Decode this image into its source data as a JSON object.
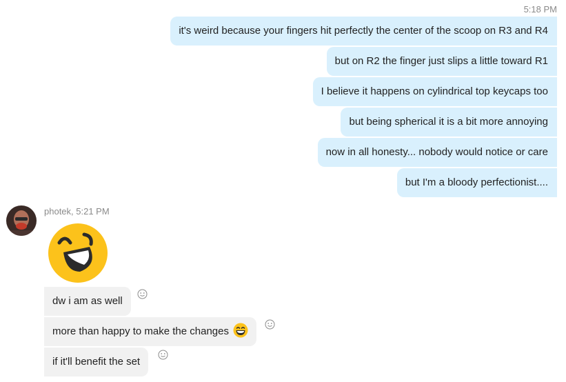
{
  "chat": {
    "outgoing_time": "5:18 PM",
    "outgoing": [
      "it's weird because your fingers hit perfectly the center of the scoop on R3 and R4",
      "but on R2 the finger just slips a little toward R1",
      "I believe it happens on cylindrical top keycaps too",
      "but being spherical it is a bit more annoying",
      "now in all honesty... nobody would notice or care",
      "but I'm a bloody perfectionist...."
    ],
    "incoming_header": "photek, 5:21 PM",
    "incoming": [
      "dw i am as well",
      "more than happy to make the changes",
      "if it'll benefit the set"
    ]
  },
  "icons": {
    "laugh_emoji": "laughing-emoji",
    "grin_emoji": "grinning-emoji",
    "reaction": "smiley-reaction-icon"
  },
  "colors": {
    "outgoing_bubble": "#d9f0fd",
    "incoming_bubble": "#f1f1f1",
    "emoji_yellow": "#fcc21b",
    "meta_text": "#8a8a8a"
  }
}
